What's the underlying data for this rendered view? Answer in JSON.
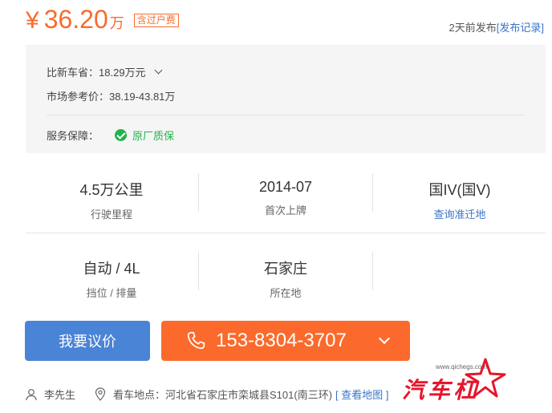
{
  "price": {
    "symbol": "¥",
    "amount": "36.20",
    "unit": "万",
    "tag": "含过户费"
  },
  "publish": {
    "time": "2天前发布",
    "record_link": "[发布记录]"
  },
  "panel": {
    "savings_label": "比新车省：",
    "savings_value": "18.29万元",
    "market_label": "市场参考价：",
    "market_value": "38.19-43.81万",
    "service_label": "服务保障：",
    "service_value": "原厂质保"
  },
  "stats": [
    {
      "value": "4.5万公里",
      "label": "行驶里程"
    },
    {
      "value": "2014-07",
      "label": "首次上牌"
    },
    {
      "value": "国IV(国V)",
      "label": "查询准迁地"
    },
    {
      "value": "自动 / 4L",
      "label": "挡位 / 排量"
    },
    {
      "value": "石家庄",
      "label": "所在地"
    }
  ],
  "buttons": {
    "bargain": "我要议价",
    "phone": "153-8304-3707"
  },
  "contact": {
    "person": "李先生",
    "location_label": "看车地点：",
    "location_value": "河北省石家庄市栾城县S101(南三环)",
    "map_link": "[ 查看地图 ]"
  },
  "watermark": {
    "url": "www.qichegs.com",
    "text": "汽车杠"
  },
  "colors": {
    "accent_orange": "#f96b2d",
    "link_blue": "#3a74c7",
    "button_blue": "#4a84d6",
    "check_green": "#24b34b",
    "logo_red": "#e5162b"
  },
  "icons": [
    "chevron-down-icon",
    "check-circle-icon",
    "phone-icon",
    "user-icon",
    "location-pin-icon"
  ]
}
